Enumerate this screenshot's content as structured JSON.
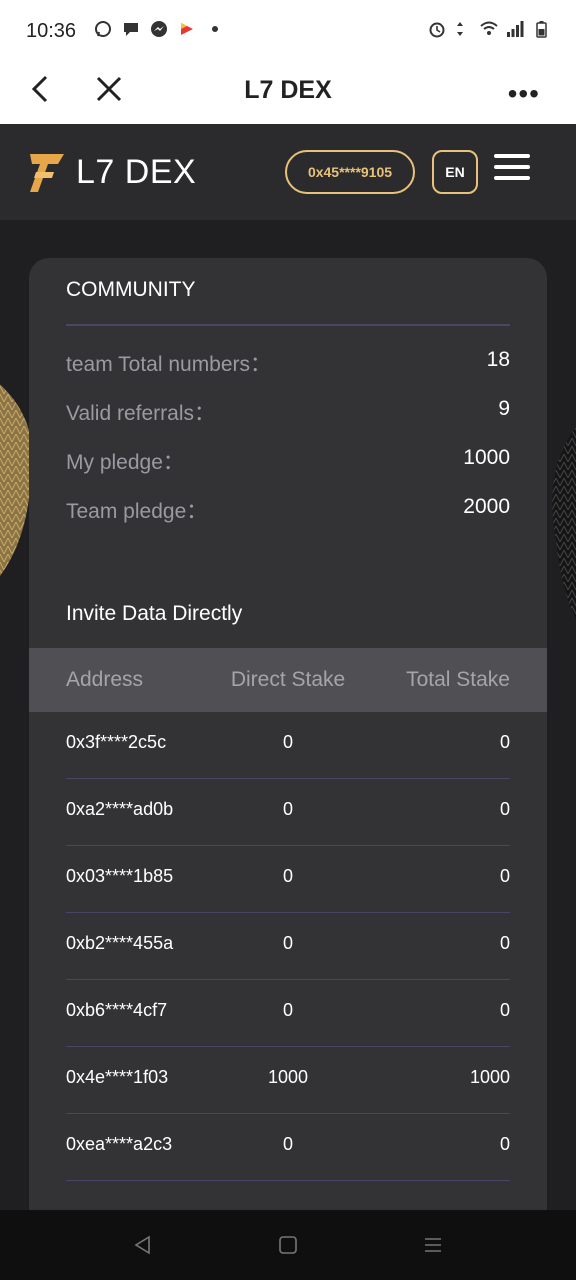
{
  "status_bar": {
    "time": "10:36",
    "left_icons": [
      "whatsapp-icon",
      "chat-bubble-icon",
      "messenger-icon",
      "app-icon",
      "dot-icon"
    ],
    "right_icons": [
      "alarm-icon",
      "data-arrows-icon",
      "wifi-icon",
      "signal-icon",
      "battery-icon"
    ]
  },
  "browser": {
    "title": "L7 DEX",
    "more_label": "•••"
  },
  "header": {
    "logo_text": "L7 DEX",
    "wallet_address": "0x45****9105",
    "language": "EN",
    "accent_color": "#e8c27a"
  },
  "community": {
    "title": "COMMUNITY",
    "stats": [
      {
        "label": "team Total  numbers：",
        "value": "18"
      },
      {
        "label": "Valid referrals：",
        "value": "9"
      },
      {
        "label": "My pledge：",
        "value": "1000"
      },
      {
        "label": "Team pledge：",
        "value": "2000"
      }
    ]
  },
  "invite": {
    "title": "Invite Data Directly",
    "columns": [
      "Address",
      "Direct Stake",
      "Total Stake"
    ],
    "rows": [
      {
        "address": "0x3f****2c5c",
        "direct": "0",
        "total": "0"
      },
      {
        "address": "0xa2****ad0b",
        "direct": "0",
        "total": "0"
      },
      {
        "address": "0x03****1b85",
        "direct": "0",
        "total": "0"
      },
      {
        "address": "0xb2****455a",
        "direct": "0",
        "total": "0"
      },
      {
        "address": "0xb6****4cf7",
        "direct": "0",
        "total": "0"
      },
      {
        "address": "0x4e****1f03",
        "direct": "1000",
        "total": "1000"
      },
      {
        "address": "0xea****a2c3",
        "direct": "0",
        "total": "0"
      }
    ]
  },
  "nav": {
    "icons": [
      "back-triangle-icon",
      "home-square-icon",
      "recents-menu-icon"
    ]
  }
}
